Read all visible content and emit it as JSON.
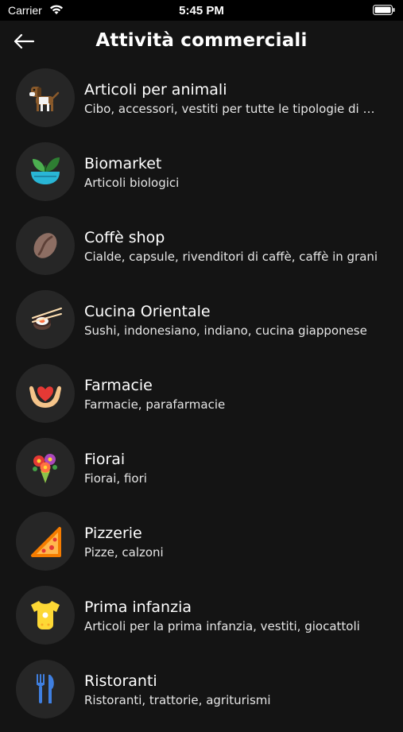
{
  "status_bar": {
    "carrier": "Carrier",
    "time": "5:45 PM"
  },
  "nav": {
    "title": "Attività commerciali",
    "back_icon": "arrow-left-icon"
  },
  "categories": [
    {
      "title": "Articoli per animali",
      "subtitle": "Cibo, accessori, vestiti per tutte le tipologie di animali",
      "icon": "dog-icon"
    },
    {
      "title": "Biomarket",
      "subtitle": "Articoli biologici",
      "icon": "plant-bowl-icon"
    },
    {
      "title": "Coffè shop",
      "subtitle": "Cialde, capsule, rivenditori di caffè, caffè in grani",
      "icon": "coffee-bean-icon"
    },
    {
      "title": "Cucina Orientale",
      "subtitle": "Sushi, indonesiano, indiano, cucina giapponese",
      "icon": "sushi-chopsticks-icon"
    },
    {
      "title": "Farmacie",
      "subtitle": "Farmacie, parafarmacie",
      "icon": "hands-heart-icon"
    },
    {
      "title": "Fiorai",
      "subtitle": "Fiorai, fiori",
      "icon": "flower-bouquet-icon"
    },
    {
      "title": "Pizzerie",
      "subtitle": "Pizze, calzoni",
      "icon": "pizza-icon"
    },
    {
      "title": "Prima infanzia",
      "subtitle": "Articoli per la prima infanzia, vestiti, giocattoli",
      "icon": "baby-onesie-icon"
    },
    {
      "title": "Ristoranti",
      "subtitle": "Ristoranti, trattorie, agriturismi",
      "icon": "cutlery-icon"
    }
  ],
  "colors": {
    "background": "#141414",
    "avatar_bg": "#262626",
    "statusbar": "#000000"
  }
}
